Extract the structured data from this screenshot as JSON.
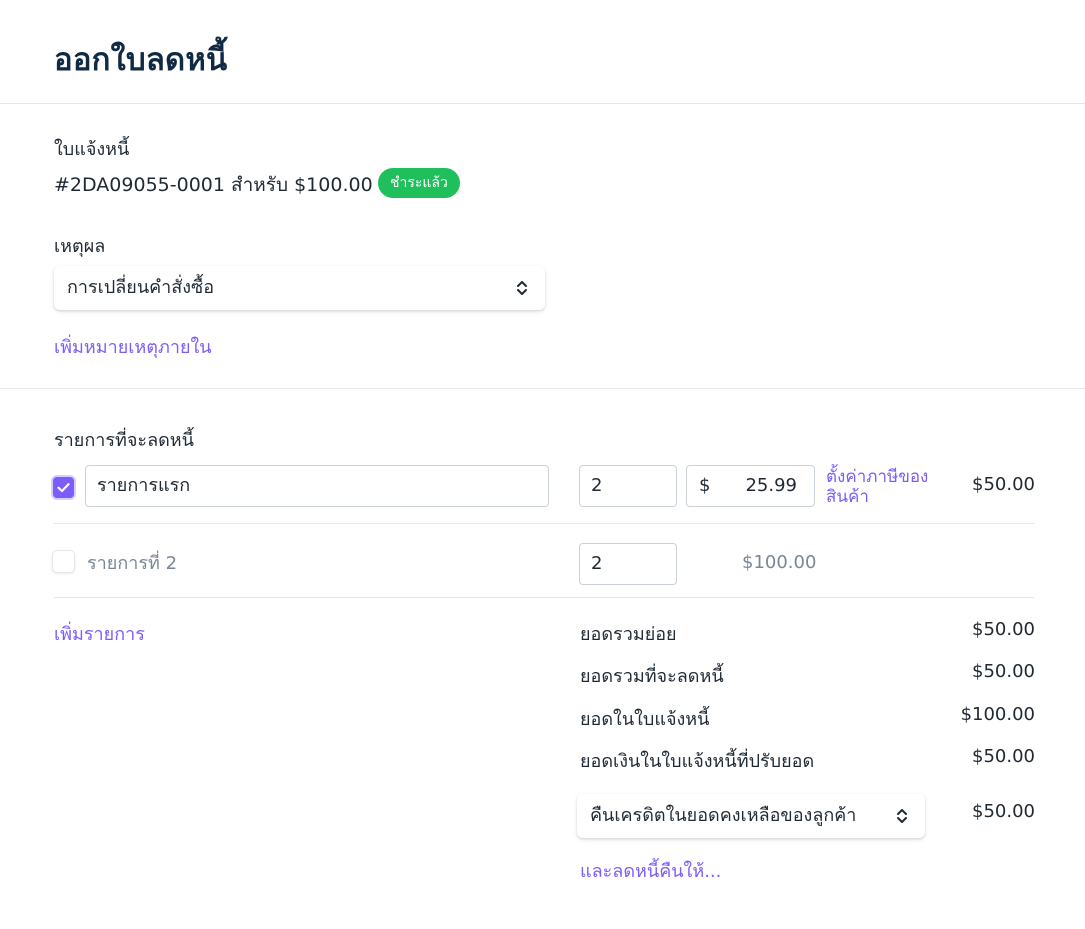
{
  "page": {
    "title": "ออกใบลดหนี้"
  },
  "invoice": {
    "label": "ใบแจ้งหนี้",
    "description": "#2DA09055-0001 สำหรับ $100.00",
    "status_badge": "ชำระแล้ว"
  },
  "reason": {
    "label": "เหตุผล",
    "selected": "การเปลี่ยนคำสั่งซื้อ",
    "add_note_link": "เพิ่มหมายเหตุภายใน"
  },
  "items": {
    "section_label": "รายการที่จะลดหนี้",
    "rows": [
      {
        "checked": true,
        "name": "รายการแรก",
        "quantity": "2",
        "currency": "$",
        "unit_price": "25.99",
        "tax_link": "ตั้งค่าภาษีของสินค้า",
        "amount": "$50.00"
      },
      {
        "checked": false,
        "name": "รายการที่ 2",
        "quantity": "2",
        "unit_price_text": "$100.00",
        "amount": ""
      }
    ],
    "add_item_link": "เพิ่มรายการ"
  },
  "summary": {
    "rows": [
      {
        "label": "ยอดรวมย่อย",
        "value": "$50.00"
      },
      {
        "label": "ยอดรวมที่จะลดหนี้",
        "value": "$50.00"
      },
      {
        "label": "ยอดในใบแจ้งหนี้",
        "value": "$100.00"
      },
      {
        "label": "ยอดเงินในใบแจ้งหนี้ที่ปรับยอด",
        "value": "$50.00"
      }
    ],
    "refund_method": "คืนเครดิตในยอดคงเหลือของลูกค้า",
    "refund_amount": "$50.00",
    "extra_link": "และลดหนี้คืนให้..."
  },
  "colors": {
    "accent": "#7c5cfa",
    "success": "#1fbf5c",
    "title": "#102a43"
  },
  "icons": {
    "select_chevron": "chevron-up-down-icon",
    "check": "check-icon"
  }
}
